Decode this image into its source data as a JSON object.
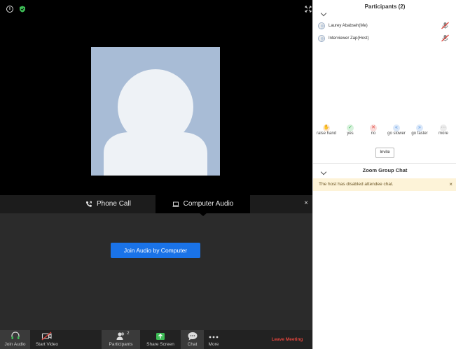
{
  "toolbar": {
    "join_audio": "Join Audio",
    "start_video": "Start Video",
    "participants": "Participants",
    "participants_count": "2",
    "share_screen": "Share Screen",
    "chat": "Chat",
    "more": "More",
    "leave_meeting": "Leave Meeting"
  },
  "audio_dialog": {
    "tab_phone": "Phone Call",
    "tab_computer": "Computer Audio",
    "join_button": "Join Audio by Computer",
    "close": "×"
  },
  "participants_panel": {
    "title": "Participants (2)",
    "participants": [
      {
        "name": "Laurey Ababseh(Me)"
      },
      {
        "name": "Interviewer Zap(Host)"
      }
    ],
    "reactions": [
      {
        "label": "raise hand",
        "color": "#f0a04b",
        "icon": "hand-icon"
      },
      {
        "label": "yes",
        "color": "#3dbb55",
        "icon": "check-icon"
      },
      {
        "label": "no",
        "color": "#e0443c",
        "icon": "x-icon"
      },
      {
        "label": "go slower",
        "color": "#4a90e2",
        "icon": "slower-icon"
      },
      {
        "label": "go faster",
        "color": "#4a90e2",
        "icon": "faster-icon"
      },
      {
        "label": "more",
        "color": "#888888",
        "icon": "more-icon"
      }
    ],
    "invite": "Invite"
  },
  "chat_panel": {
    "title": "Zoom Group Chat",
    "banner": "The host has disabled attendee chat.",
    "banner_close": "×"
  },
  "colors": {
    "accent": "#1a73e8",
    "leave": "#e0443c",
    "share": "#3dbb55",
    "banner_bg": "#fdf3d8"
  }
}
